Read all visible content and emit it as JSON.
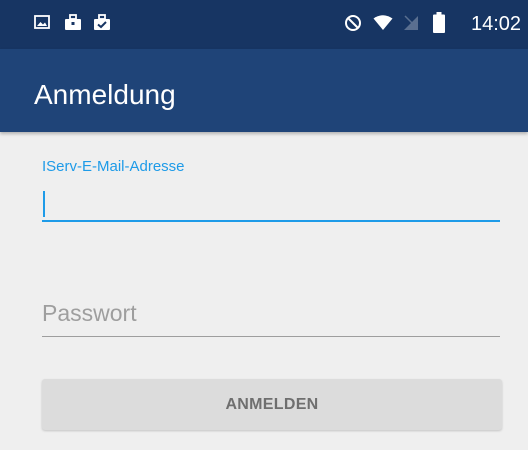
{
  "status_bar": {
    "time": "14:02",
    "icons": [
      "image-icon",
      "briefcase-icon",
      "briefcase-check-icon",
      "do-not-disturb-icon",
      "wifi-icon",
      "no-signal-icon",
      "battery-icon"
    ]
  },
  "app_bar": {
    "title": "Anmeldung"
  },
  "form": {
    "email_label": "IServ-E-Mail-Adresse",
    "email_value": "",
    "password_placeholder": "Passwort",
    "password_value": "",
    "login_button_label": "ANMELDEN"
  },
  "colors": {
    "status_bar_bg": "#173563",
    "app_bar_bg": "#1f4478",
    "accent": "#1e9be8",
    "background": "#efefef",
    "button_bg": "#dcdcdc"
  }
}
